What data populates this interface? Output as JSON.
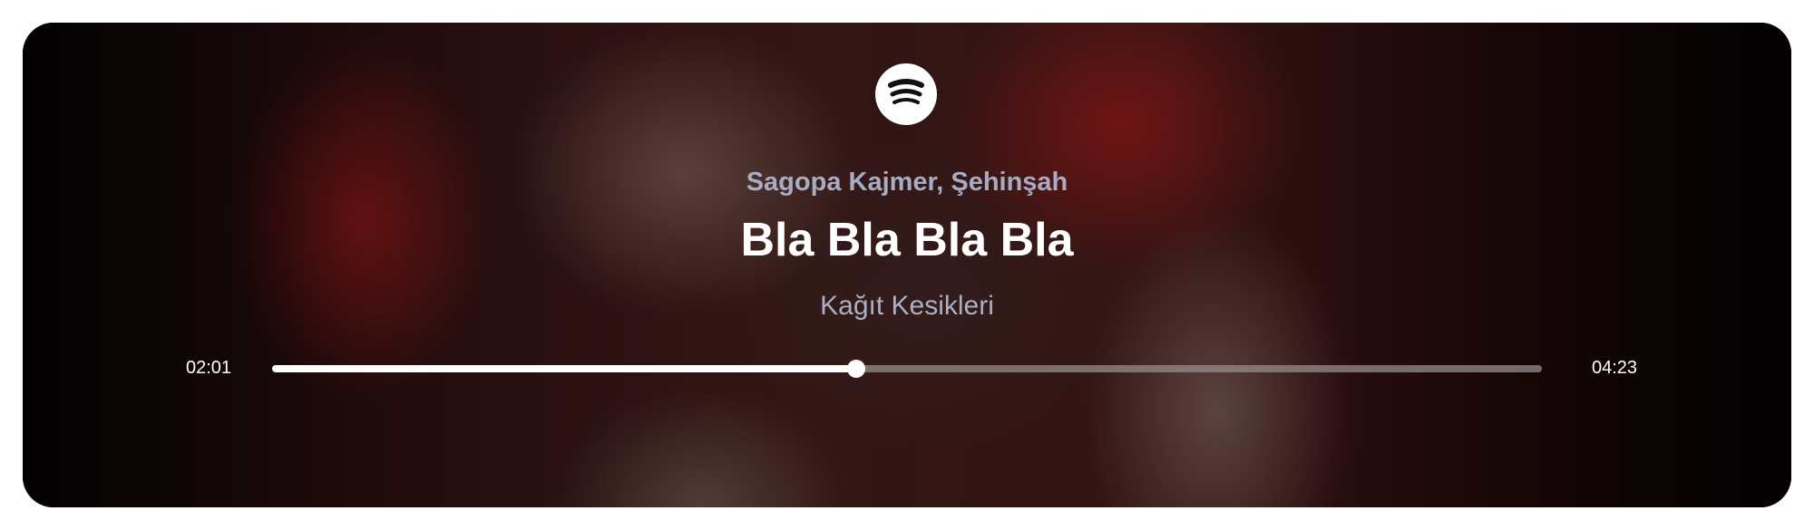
{
  "player": {
    "logo_icon": "spotify-icon",
    "artist": "Sagopa Kajmer, Şehinşah",
    "title": "Bla Bla Bla Bla",
    "album": "Kağıt Kesikleri",
    "current_time": "02:01",
    "total_time": "04:23",
    "progress_fraction": 0.46
  },
  "colors": {
    "artist_text": "#a6adc3",
    "title_text": "#ffffff",
    "album_text": "#aab0c4",
    "progress_fill": "#ffffff",
    "progress_track": "#968c8c"
  }
}
